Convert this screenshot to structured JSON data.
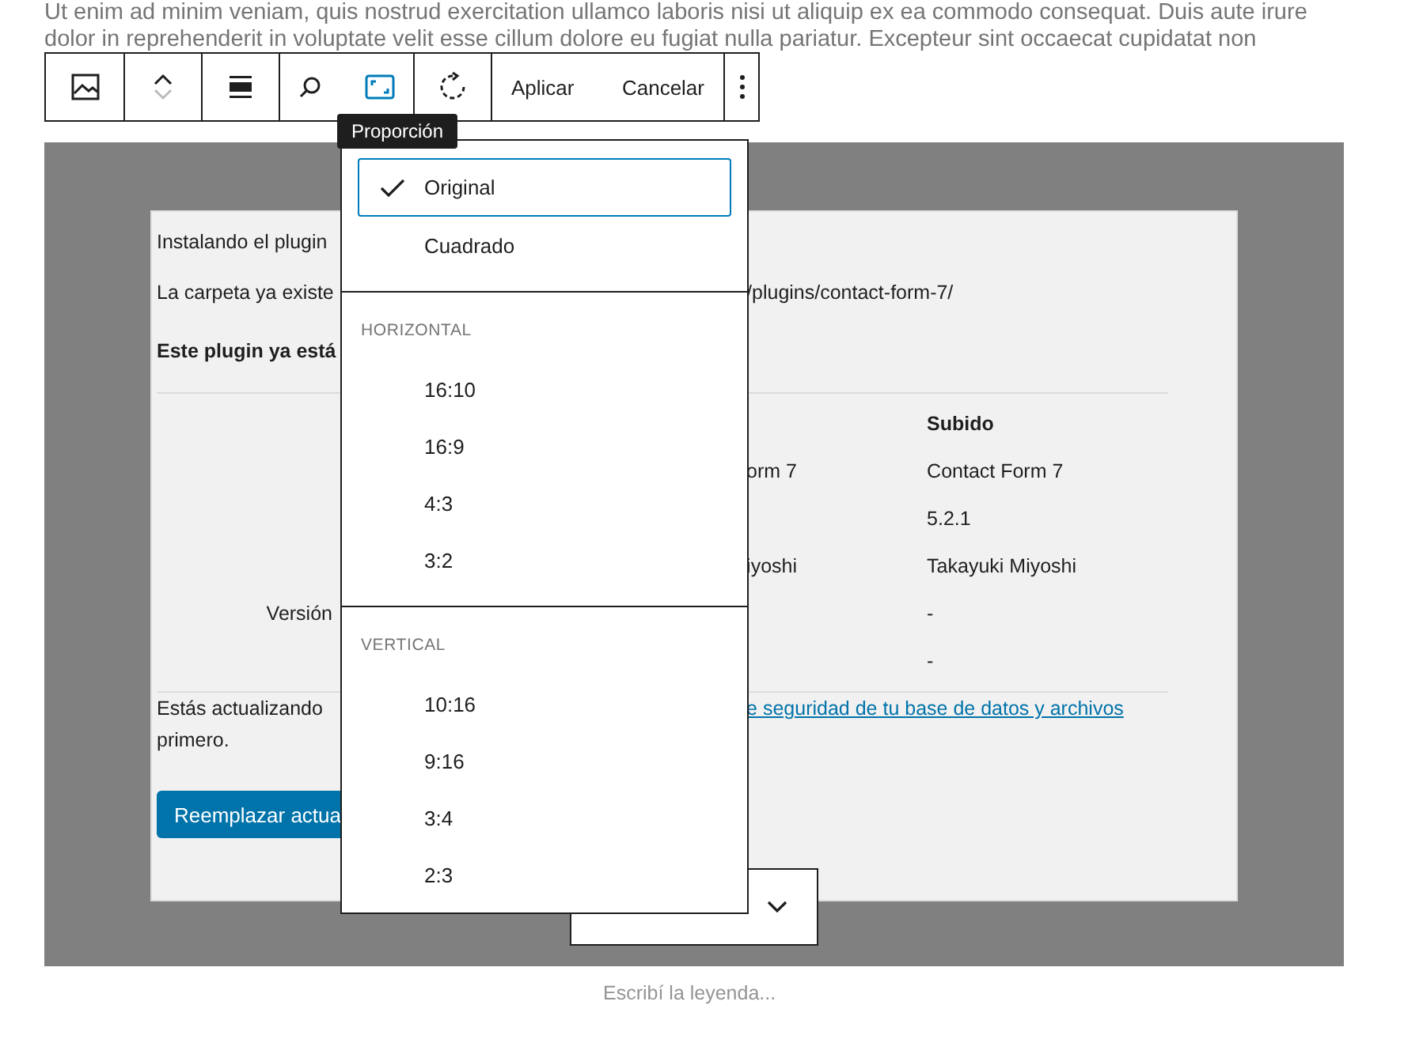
{
  "body_text": [
    "Ut enim ad minim veniam, quis nostrud exercitation ullamco laboris nisi ut aliquip ex ea commodo consequat. Duis aute irure",
    "dolor in reprehenderit in voluptate velit esse cillum dolore eu fugiat nulla pariatur. Excepteur sint occaecat cupidatat non"
  ],
  "toolbar": {
    "aspect_ratio_pressed": true,
    "actions": [
      "Aplicar",
      "Cancelar"
    ]
  },
  "tooltip": "Proporción",
  "screenshot": {
    "status": "Instalando el plugin",
    "folder_left": "La carpeta ya existe",
    "folder_right": "/plugins/contact-form-7/",
    "notice": "Este plugin ya está",
    "table": {
      "header": "Subido",
      "rows": [
        {
          "col_2": "orm 7",
          "col_3": "Contact Form 7"
        },
        {
          "col_3": "5.2.1"
        },
        {
          "col_2": "iyoshi",
          "col_3": "Takayuki Miyoshi"
        },
        {
          "col_1": "Versión",
          "col_3": "-"
        },
        {
          "col_3": "-"
        }
      ]
    },
    "warning": [
      "Estás actualizando",
      "primero."
    ],
    "warning_link": "e seguridad de tu base de datos y archivos",
    "button": "Reemplazar actua"
  },
  "menu": {
    "groups": [
      {
        "items": [
          {
            "label": "Original",
            "selected": true
          },
          {
            "label": "Cuadrado",
            "selected": false
          }
        ]
      },
      {
        "heading": "HORIZONTAL",
        "items": [
          {
            "label": "16:10",
            "selected": false
          },
          {
            "label": "16:9",
            "selected": false
          },
          {
            "label": "4:3",
            "selected": false
          },
          {
            "label": "3:2",
            "selected": false
          }
        ]
      },
      {
        "heading": "VERTICAL",
        "items": [
          {
            "label": "10:16",
            "selected": false
          },
          {
            "label": "9:16",
            "selected": false
          },
          {
            "label": "3:4",
            "selected": false
          },
          {
            "label": "2:3",
            "selected": false
          }
        ]
      }
    ]
  },
  "caption_placeholder": "Escribí la leyenda..."
}
